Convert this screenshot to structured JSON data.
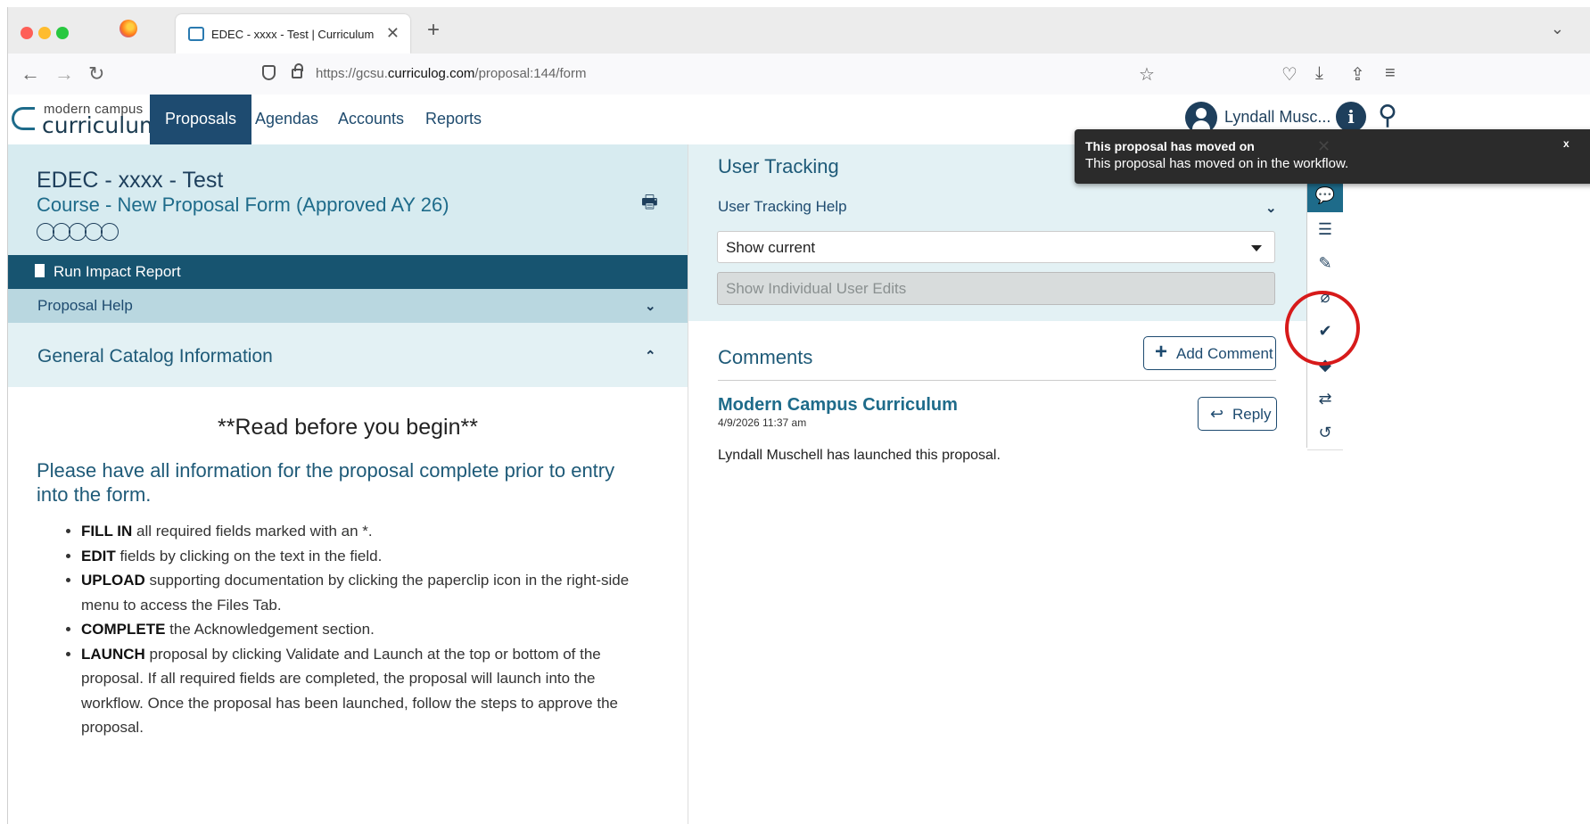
{
  "browser": {
    "tab_title": "EDEC - xxxx - Test | Curriculum",
    "tab_close": "✕",
    "new_tab": "+",
    "url_prefix": "https://gcsu.",
    "url_domain": "curriculog.com",
    "url_path": "/proposal:144/form"
  },
  "app": {
    "logo_top": "modern campus",
    "logo_bottom": "curriculum",
    "nav": {
      "proposals": "Proposals",
      "agendas": "Agendas",
      "accounts": "Accounts",
      "reports": "Reports"
    },
    "user_name": "Lyndall Musc..."
  },
  "proposal": {
    "title": "EDEC - xxxx - Test",
    "subtitle": "Course - New Proposal Form (Approved AY 26)",
    "impact_report": "Run Impact Report",
    "help": "Proposal Help",
    "section": "General Catalog Information",
    "read_before": "**Read before you begin**",
    "intro": "Please have all information for the proposal complete prior to entry into the form.",
    "instructions": [
      {
        "bold": "FILL IN",
        "text": " all required fields marked with an *."
      },
      {
        "bold": "EDIT",
        "text": " fields by clicking on the text in the field."
      },
      {
        "bold": "UPLOAD",
        "text": " supporting documentation by clicking the paperclip icon in the right-side menu to access the Files Tab."
      },
      {
        "bold": "COMPLETE",
        "text": " the Acknowledgement section."
      },
      {
        "bold": "LAUNCH",
        "text": " proposal by clicking Validate and Launch at the top or bottom of the proposal.  If all required fields are completed, the proposal will launch into the workflow. Once the proposal has been launched, follow the steps to approve the proposal."
      }
    ]
  },
  "tracking": {
    "title": "User Tracking",
    "help": "User Tracking Help",
    "select_value": "Show current",
    "individual_edits": "Show Individual User Edits"
  },
  "comments": {
    "title": "Comments",
    "add_label": "Add Comment",
    "add_plus": "+",
    "items": [
      {
        "author": "Modern Campus Curriculum",
        "date": "4/9/2026 11:37 am",
        "text": "Lyndall Muschell has launched this proposal.",
        "reply_label": "Reply"
      }
    ]
  },
  "sidebar_icons": [
    "close-icon",
    "comment-icon",
    "list-icon",
    "edit-form-icon",
    "paperclip-icon",
    "checkmark-icon",
    "tag-icon",
    "shuffle-icon",
    "history-icon"
  ],
  "toast": {
    "title": "This proposal has moved on",
    "message": "This proposal has moved on in the workflow.",
    "close": "x"
  },
  "colors": {
    "primary_navy": "#1e4b70",
    "teal_bar": "#175470",
    "light_panel": "#e3f1f4",
    "annotation_red": "#d71a1a"
  }
}
